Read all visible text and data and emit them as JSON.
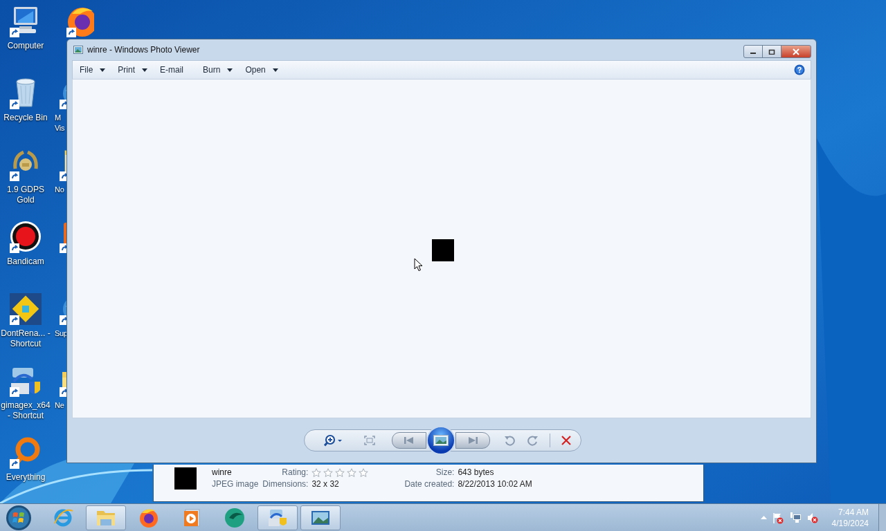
{
  "desktop": {
    "icons": [
      {
        "kind": "computer",
        "label": "Computer",
        "covered": false
      },
      {
        "kind": "recycle",
        "label": "Recycle Bin",
        "covered": false
      },
      {
        "kind": "laurel",
        "label": "1.9 GDPS Gold",
        "covered": false
      },
      {
        "kind": "record",
        "label": "Bandicam",
        "covered": false
      },
      {
        "kind": "cube",
        "label": "DontRena... - Shortcut",
        "covered": false
      },
      {
        "kind": "installer",
        "label": "gimagex_x64 - Shortcut",
        "covered": false
      },
      {
        "kind": "ring",
        "label": "Everything",
        "covered": false
      },
      {
        "kind": "firefox",
        "covered": true
      },
      {
        "kind": "globe",
        "label": "M Vis",
        "covered": true
      },
      {
        "kind": "notepad",
        "label": "No",
        "covered": true
      },
      {
        "kind": "tile",
        "covered": true
      },
      {
        "kind": "globe",
        "label": "Sup",
        "covered": true
      },
      {
        "kind": "folder",
        "label": "Ne",
        "covered": true
      }
    ]
  },
  "window": {
    "title": "winre - Windows Photo Viewer",
    "menu": [
      {
        "label": "File",
        "dropdown": true
      },
      {
        "label": "Print",
        "dropdown": true
      },
      {
        "label": "E-mail",
        "dropdown": false
      },
      {
        "label": "Burn",
        "dropdown": true
      },
      {
        "label": "Open",
        "dropdown": true
      }
    ]
  },
  "details": {
    "name": "winre",
    "type": "JPEG image",
    "rating_label": "Rating:",
    "stars": 0,
    "dimensions_label": "Dimensions:",
    "dimensions": "32 x 32",
    "size_label": "Size:",
    "size": "643 bytes",
    "date_label": "Date created:",
    "date": "8/22/2013 10:02 AM"
  },
  "taskbar": {
    "items": [
      {
        "kind": "ie",
        "running": false
      },
      {
        "kind": "explorer",
        "running": true
      },
      {
        "kind": "firefox",
        "running": false
      },
      {
        "kind": "media",
        "running": false
      },
      {
        "kind": "green",
        "running": false
      },
      {
        "kind": "installer",
        "running": true
      },
      {
        "kind": "photo",
        "running": true
      }
    ],
    "time": "7:44 AM",
    "date": "4/19/2024"
  }
}
